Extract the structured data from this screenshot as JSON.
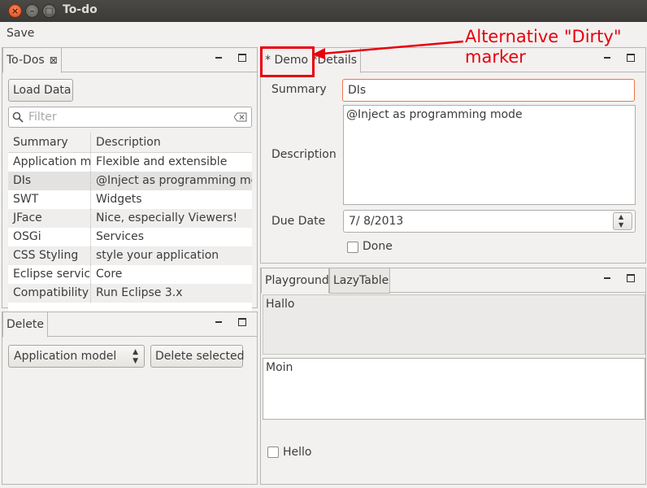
{
  "window": {
    "title": "To-do"
  },
  "menu": {
    "save": "Save"
  },
  "todos_panel": {
    "tab_label": "To-Dos",
    "load_button": "Load Data",
    "filter_placeholder": "Filter",
    "columns": [
      "Summary",
      "Description"
    ],
    "rows": [
      {
        "summary": "Application model",
        "description": "Flexible and extensible"
      },
      {
        "summary": "DIs",
        "description": "@Inject as programming mode"
      },
      {
        "summary": "SWT",
        "description": "Widgets"
      },
      {
        "summary": "JFace",
        "description": "Nice, especially Viewers!"
      },
      {
        "summary": "OSGi",
        "description": "Services"
      },
      {
        "summary": "CSS Styling",
        "description": "style your application"
      },
      {
        "summary": "Eclipse services",
        "description": "Core"
      },
      {
        "summary": "Compatibility",
        "description": "Run Eclipse 3.x"
      }
    ],
    "selected_row": 1
  },
  "delete_panel": {
    "tab_label": "Delete",
    "combo_value": "Application model",
    "delete_button": "Delete selected"
  },
  "details_panel": {
    "tab_label": "* Demo *Details",
    "summary_label": "Summary",
    "summary_value": "DIs",
    "description_label": "Description",
    "description_value": "@Inject as programming mode",
    "due_date_label": "Due Date",
    "due_date_value": "7/ 8/2013",
    "done_label": "Done",
    "done_checked": false
  },
  "playground_panel": {
    "tabs": [
      "Playground",
      "LazyTable"
    ],
    "active_tab": 0,
    "text1": "Hallo",
    "text2": "Moin",
    "checkbox_label": "Hello"
  },
  "annotation": {
    "text_line1": "Alternative \"Dirty\"",
    "text_line2": "marker",
    "color": "#e8000b"
  },
  "colors": {
    "titlebar": "#3c3b37",
    "background": "#f2f1f0",
    "focus_border": "#f07746"
  }
}
